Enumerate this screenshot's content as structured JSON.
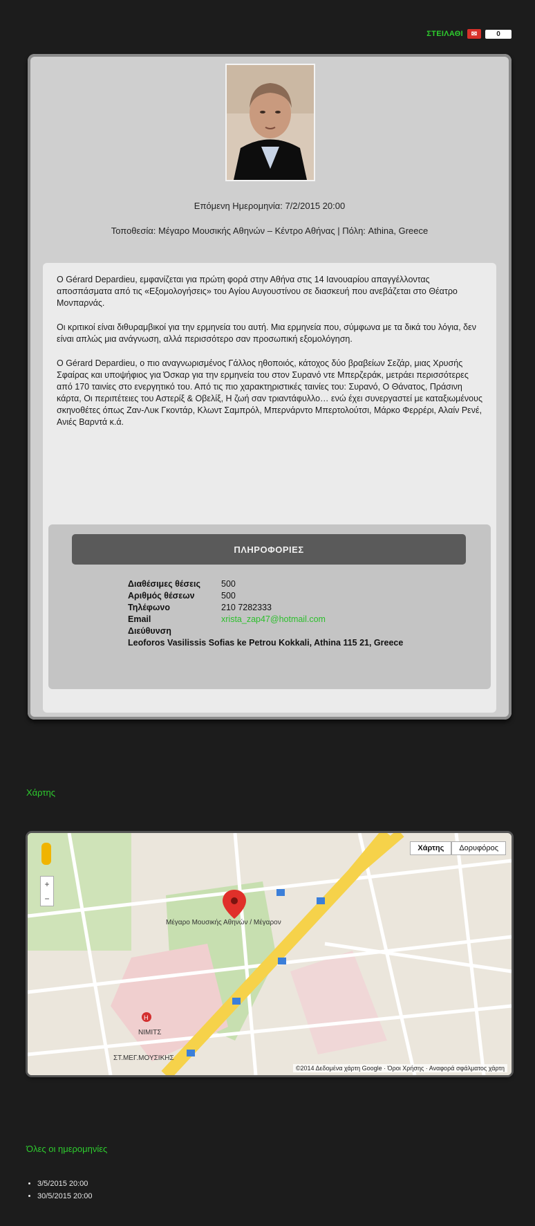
{
  "share": {
    "label": "ΣΤΕΙΛΑΘΙ",
    "count": "0"
  },
  "event": {
    "next_date": "Επόμενη Ημερομηνία: 7/2/2015 20:00",
    "location": "Τοποθεσία: Μέγαρο Μουσικής Αθηνών – Κέντρο Αθήνας | Πόλη: Athina, Greece",
    "description": [
      "Ο Gérard Depardieu, εμφανίζεται για πρώτη φορά στην Αθήνα στις 14 Ιανουαρίου απαγγέλλοντας αποσπάσματα από τις «Εξομολογήσεις» του Αγίου Αυγουστίνου σε διασκευή που ανεβάζεται στο Θέατρο Μονπαρνάς.",
      "Οι κριτικοί είναι διθυραμβικοί για την ερμηνεία του αυτή. Μια ερμηνεία που, σύμφωνα με τα δικά του λόγια, δεν είναι απλώς μια ανάγνωση, αλλά περισσότερο σαν προσωπική εξομολόγηση.",
      "Ο Gérard Depardieu, ο πιο αναγνωρισμένος Γάλλος ηθοποιός, κάτοχος δύο βραβείων Σεζάρ, μιας Χρυσής Σφαίρας και υποψήφιος για Όσκαρ για την ερμηνεία του στον Συρανό ντε Μπερζεράκ, μετράει περισσότερες από 170 ταινίες στο ενεργητικό του. Από τις πιο χαρακτηριστικές ταινίες του: Συρανό, Ο Θάνατος, Πράσινη κάρτα, Οι περιπέτειες του Αστερίξ & Οβελίξ, Η ζωή σαν τριαντάφυλλο… ενώ έχει συνεργαστεί με καταξιωμένους σκηνοθέτες όπως Ζαν-Λυκ Γκοντάρ, Κλωντ Σαμπρόλ, Μπερνάρντο Μπερτολούτσι, Μάρκο Φερρέρι, Αλαίν Ρενέ, Ανιές Βαρντά κ.ά."
    ],
    "info": {
      "header": "ΠΛΗΡΟΦΟΡΙΕΣ",
      "rows": [
        {
          "label": "Διαθέσιμες θέσεις",
          "value": "500"
        },
        {
          "label": "Αριθμός θέσεων",
          "value": "500"
        },
        {
          "label": "Τηλέφωνο",
          "value": "210 7282333"
        },
        {
          "label": "Email",
          "value": "xrista_zap47@hotmail.com"
        }
      ],
      "address_label": "Διεύθυνση",
      "address_value": "Leoforos Vasilissis Sofias ke Petrou Kokkali, Athina 115 21, Greece"
    }
  },
  "map_section": {
    "title": "Χάρτης",
    "buttons": {
      "map": "Χάρτης",
      "satellite": "Δορυφόρος"
    },
    "attribution": "©2014 Δεδομένα χάρτη Google · Όροι Χρήσης · Αναφορά σφάλματος χάρτη",
    "labels": {
      "venue": "Μέγαρο Μουσικής Αθηνών / Μέγαρον",
      "metro": "ΣΤ.ΜΕΓ.ΜΟΥΣΙΚΗΣ",
      "hospital": "ΝΙΜΙΤΣ"
    }
  },
  "dates_section": {
    "title": "Όλες οι ημερομηνίες",
    "items": [
      "3/5/2015 20:00",
      "30/5/2015 20:00"
    ]
  }
}
